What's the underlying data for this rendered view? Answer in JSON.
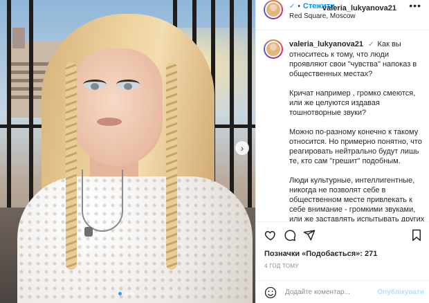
{
  "post": {
    "username": "valeria_lukyanova21",
    "verified_symbol": "✓",
    "separator": "•",
    "follow_label": "Стежити",
    "location": "Red Square, Moscow",
    "more_symbol": "•••",
    "caption_paragraphs": [
      "Как вы относитесь к тому, что люди проявляют свои \"чувства\" напоказ в общественных местах?",
      "Кричат например , громко смеются, или же целуются издавая тошнотворные звуки?",
      "Можно по-разному конечно к такому относится. Но примерно понятно, что реагировать нейтрально будут лишь те, кто сам \"грешит\" подобным.",
      "Люди культурные, интеллигентные, никогда не позволят себе в общественном месте привлекать к себе внимание - громкими звуками, или же заставлять испытывать других"
    ],
    "likes_text": "Позначки «Подобається»: 271",
    "time_ago": "4 ГОД ТОМУ",
    "comment_placeholder": "Додайте коментар...",
    "publish_label": "Опублікувати",
    "next_symbol": "›",
    "carousel": {
      "count": 3,
      "active_index": 0
    }
  },
  "icons": {
    "like": "heart-icon",
    "comment": "comment-icon",
    "share": "share-icon",
    "save": "bookmark-icon",
    "emoji": "emoji-icon"
  },
  "colors": {
    "link_blue": "#0095f6",
    "verified_blue": "#3897f0",
    "publish_disabled": "#b2dffc",
    "muted": "#8e8e8e"
  }
}
